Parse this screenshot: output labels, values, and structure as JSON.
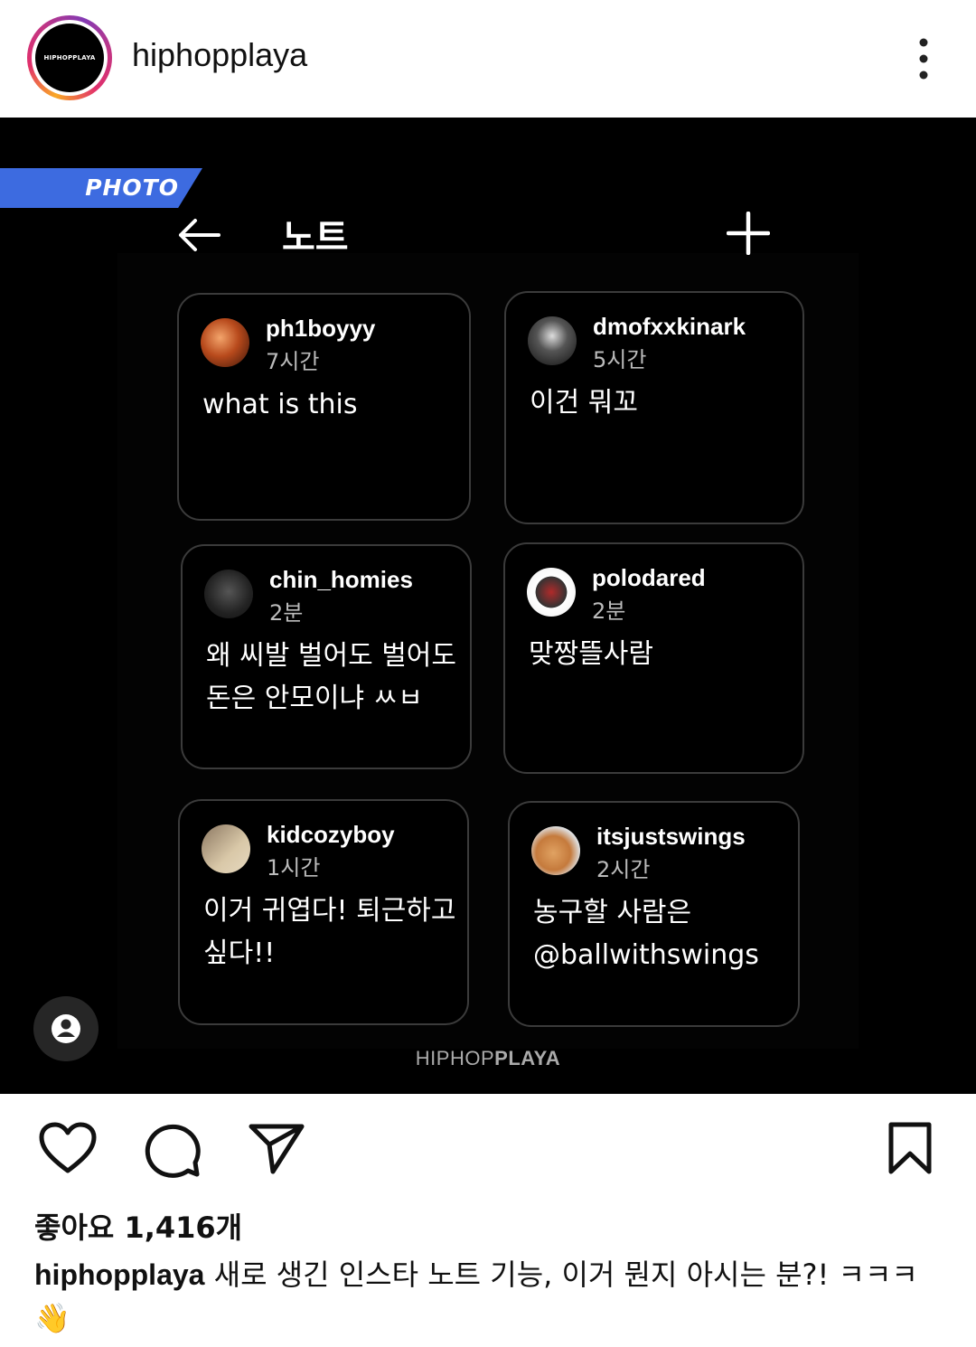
{
  "header": {
    "username": "hiphopplaya",
    "avatar_text": "HIPHOPPLAYA"
  },
  "post_image": {
    "tag": "PHOTO",
    "title": "노트",
    "notes": [
      {
        "name": "ph1boyyy",
        "time": "7시간",
        "text": "what is this"
      },
      {
        "name": "dmofxxkinark",
        "time": "5시간",
        "text": "이건 뭐꼬"
      },
      {
        "name": "chin_homies",
        "time": "2분",
        "text": "왜 씨발 벌어도 벌어도 돈은 안모이냐 ㅆㅂ"
      },
      {
        "name": "polodared",
        "time": "2분",
        "text": "맞짱뜰사람"
      },
      {
        "name": "kidcozyboy",
        "time": "1시간",
        "text": "이거 귀엽다! 퇴근하고싶다!!"
      },
      {
        "name": "itsjustswings",
        "time": "2시간",
        "text": "농구할 사람은 @ballwithswings"
      }
    ],
    "watermark_a": "HIPHOP",
    "watermark_b": "PLAYA"
  },
  "post": {
    "likes": "좋아요 1,416개",
    "caption_user": "hiphopplaya",
    "caption_text": " 새로 생긴 인스타 노트 기능, 이거 뭔지 아시는 분?! ㅋㅋㅋ 👋"
  }
}
